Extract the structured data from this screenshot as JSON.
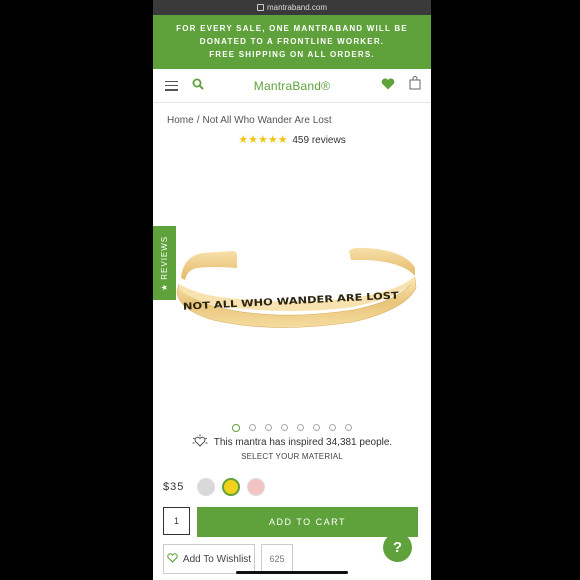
{
  "browser": {
    "url": "mantraband.com"
  },
  "promo": {
    "line1": "FOR EVERY SALE, ONE MANTRABAND WILL BE",
    "line2": "DONATED TO A FRONTLINE WORKER.",
    "line3": "FREE SHIPPING ON ALL ORDERS."
  },
  "header": {
    "logo": "MantraBand®"
  },
  "breadcrumb": {
    "home": "Home",
    "separator": "/",
    "current": "Not All Who Wander Are Lost"
  },
  "rating": {
    "stars": "★★★★★",
    "reviews": "459 reviews"
  },
  "product": {
    "engraving": "NOT ALL WHO WANDER ARE LOST"
  },
  "side_tab": {
    "label": "★ REVIEWS"
  },
  "carousel": {
    "count": 8,
    "active_index": 0
  },
  "inspire": {
    "text": "This mantra has inspired 34,381 people."
  },
  "material": {
    "prompt": "SELECT YOUR MATERIAL",
    "swatches": [
      {
        "name": "silver",
        "color": "#d9d9d9"
      },
      {
        "name": "gold",
        "color": "#f2d11c",
        "selected": true
      },
      {
        "name": "rose-gold",
        "color": "#f3c2c2"
      }
    ]
  },
  "price": "$35",
  "quantity": "1",
  "add_to_cart": "ADD TO CART",
  "wishlist": {
    "label": "Add To Wishlist",
    "count": "625"
  },
  "help": "?",
  "colors": {
    "brand_green": "#5fa23b",
    "star_yellow": "#f2c514"
  }
}
